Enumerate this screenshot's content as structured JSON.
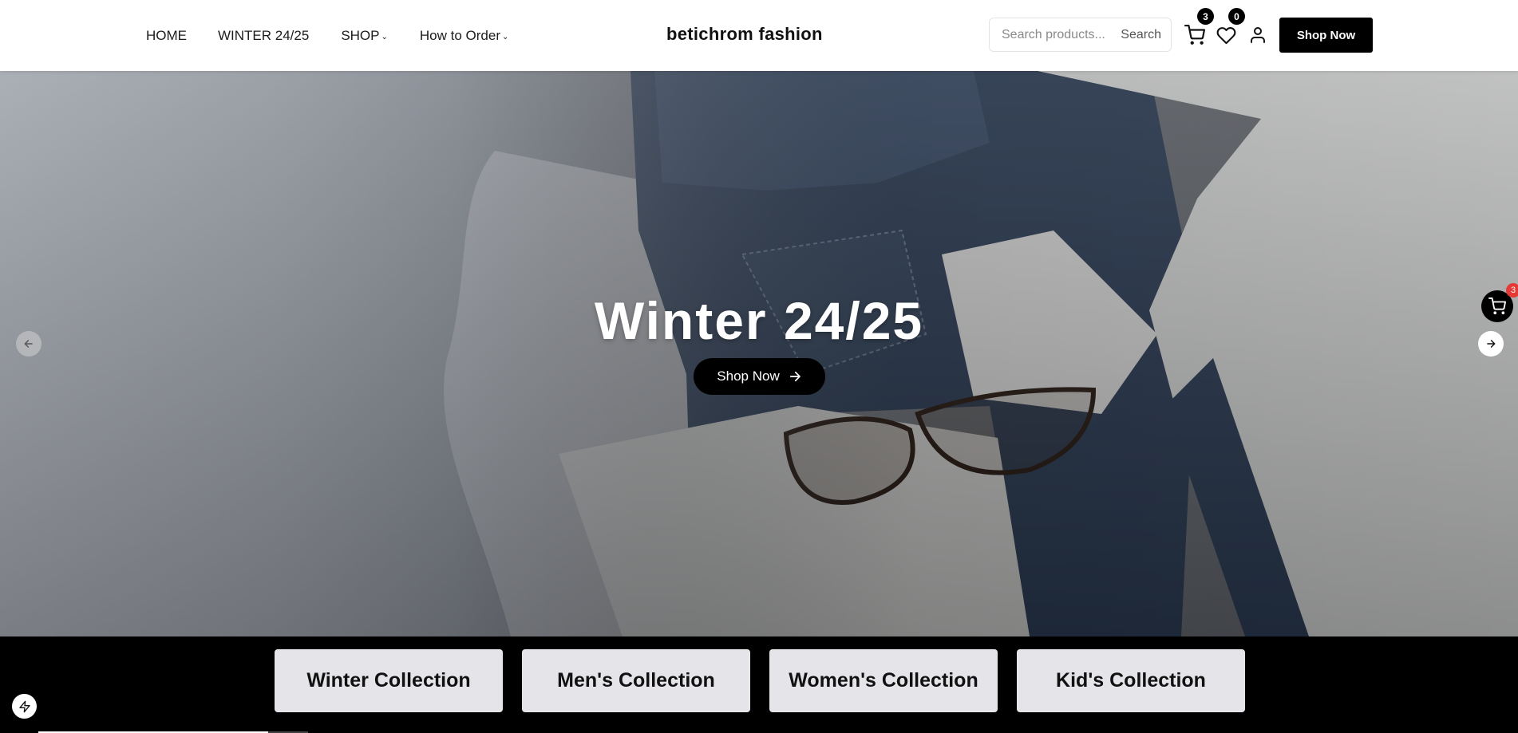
{
  "header": {
    "nav": [
      {
        "label": "HOME"
      },
      {
        "label": "WINTER 24/25"
      },
      {
        "label": "SHOP"
      },
      {
        "label": "How to Order"
      }
    ],
    "brand": "betichrom fashion",
    "search": {
      "placeholder": "Search products...",
      "button": "Search"
    },
    "cart_count": "3",
    "wishlist_count": "0",
    "shop_now": "Shop Now"
  },
  "hero": {
    "title": "Winter 24/25",
    "cta": "Shop Now"
  },
  "floating_cart_count": "3",
  "collections": [
    {
      "label": "Winter Collection"
    },
    {
      "label": "Men's Collection"
    },
    {
      "label": "Women's Collection"
    },
    {
      "label": "Kid's Collection"
    }
  ],
  "colors": {
    "accent": "#000000",
    "badge_red": "#e53935",
    "collection_bg": "#e4e4e9"
  },
  "icons": [
    "cart-icon",
    "heart-icon",
    "user-icon",
    "arrow-left-icon",
    "arrow-right-icon",
    "bolt-icon"
  ]
}
